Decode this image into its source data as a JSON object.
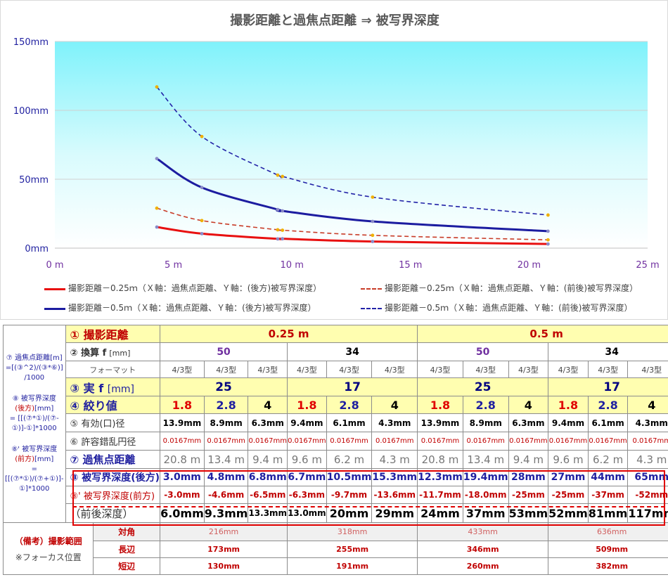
{
  "chart_data": {
    "type": "line",
    "title": "撮影距離と過焦点距離 ⇒ 被写界深度",
    "xlim": [
      0,
      25
    ],
    "ylim": [
      0,
      150
    ],
    "x_ticks": [
      "0 m",
      "5 m",
      "10 m",
      "15 m",
      "20 m",
      "25 m"
    ],
    "y_ticks": [
      "0mm",
      "50mm",
      "100mm",
      "150mm"
    ],
    "legend_position": "bottom",
    "series": [
      {
        "name": "撮影距離－0.25ｍ（Ｘ軸：過焦点距離、Ｙ軸：(後方)被写界深度）",
        "color": "#e81010",
        "dash": false,
        "width": 3,
        "points": [
          [
            4.3,
            15.3
          ],
          [
            6.2,
            10.5
          ],
          [
            9.4,
            6.7
          ],
          [
            9.6,
            6.8
          ],
          [
            13.4,
            4.8
          ],
          [
            20.8,
            3.0
          ]
        ]
      },
      {
        "name": "撮影距離－0.25ｍ（Ｘ軸：過焦点距離、Ｙ軸：(前後)被写界深度）",
        "color": "#c83c28",
        "dash": true,
        "width": 1.6,
        "points": [
          [
            4.3,
            29
          ],
          [
            6.2,
            20
          ],
          [
            9.4,
            13.3
          ],
          [
            9.6,
            13.0
          ],
          [
            13.4,
            9.3
          ],
          [
            20.8,
            6.0
          ]
        ]
      },
      {
        "name": "撮影距離－0.5ｍ（Ｘ軸：過焦点距離、Ｙ軸：(後方)被写界深度）",
        "color": "#1c1ca0",
        "dash": false,
        "width": 3,
        "points": [
          [
            4.3,
            65
          ],
          [
            6.2,
            44
          ],
          [
            9.4,
            28
          ],
          [
            9.6,
            27
          ],
          [
            13.4,
            19.4
          ],
          [
            20.8,
            12.3
          ]
        ]
      },
      {
        "name": "撮影距離－0.5ｍ（Ｘ軸：過焦点距離、Ｙ軸：(前後)被写界深度）",
        "color": "#2323a8",
        "dash": true,
        "width": 1.6,
        "points": [
          [
            4.3,
            117
          ],
          [
            6.2,
            81
          ],
          [
            9.4,
            53
          ],
          [
            9.6,
            52
          ],
          [
            13.4,
            37
          ],
          [
            20.8,
            24
          ]
        ]
      }
    ]
  },
  "table": {
    "side_hyperfocal": "⑦ 過焦点距離[m] =[(③^2)/(③*⑥)] /1000",
    "side_rear_t1": "⑧ 被写界深度",
    "side_rear_t2": "(後方)",
    "side_rear_t3": "[mm]",
    "side_rear_f": "= [[(⑦*①)/(⑦-①)]-①]*1000",
    "side_front_t1": "⑧' 被写界深度",
    "side_front_t2": "(前方)",
    "side_front_t3": "[mm]",
    "side_front_f": "= [[(⑦*①)/(⑦+①)]-①]*1000",
    "row_distance": {
      "label": "① 撮影距離",
      "v025": "0.25 m",
      "v05": "0.5 m"
    },
    "row_equiv": {
      "label": "② 換算 f",
      "unit": "[mm]",
      "vals": [
        "50",
        "34",
        "50",
        "34"
      ]
    },
    "row_format": {
      "label": "フォーマット",
      "vals": [
        "4/3型",
        "4/3型",
        "4/3型",
        "4/3型",
        "4/3型",
        "4/3型",
        "4/3型",
        "4/3型",
        "4/3型",
        "4/3型",
        "4/3型",
        "4/3型"
      ]
    },
    "row_actual": {
      "label": "③ 実 f",
      "unit": "[mm]",
      "vals": [
        "25",
        "17",
        "25",
        "17"
      ]
    },
    "row_fnum": {
      "label": "④ 絞り値",
      "vals": [
        "1.8",
        "2.8",
        "4",
        "1.8",
        "2.8",
        "4",
        "1.8",
        "2.8",
        "4",
        "1.8",
        "2.8",
        "4"
      ]
    },
    "row_diameter": {
      "label": "⑤ 有効(口)径",
      "vals": [
        "13.9mm",
        "8.9mm",
        "6.3mm",
        "9.4mm",
        "6.1mm",
        "4.3mm",
        "13.9mm",
        "8.9mm",
        "6.3mm",
        "9.4mm",
        "6.1mm",
        "4.3mm"
      ]
    },
    "row_coc": {
      "label": "⑥ 許容錯乱円径",
      "vals": [
        "0.0167mm",
        "0.0167mm",
        "0.0167mm",
        "0.0167mm",
        "0.0167mm",
        "0.0167mm",
        "0.0167mm",
        "0.0167mm",
        "0.0167mm",
        "0.0167mm",
        "0.0167mm",
        "0.0167mm"
      ]
    },
    "row_hyper": {
      "label": "⑦ 過焦点距離",
      "vals": [
        "20.8 m",
        "13.4 m",
        "9.4 m",
        "9.6 m",
        "6.2 m",
        "4.3 m",
        "20.8 m",
        "13.4 m",
        "9.4 m",
        "9.6 m",
        "6.2 m",
        "4.3 m"
      ]
    },
    "row_rear": {
      "label": "⑧ 被写界深度(後方)",
      "vals": [
        "3.0mm",
        "4.8mm",
        "6.8mm",
        "6.7mm",
        "10.5mm",
        "15.3mm",
        "12.3mm",
        "19.4mm",
        "28mm",
        "27mm",
        "44mm",
        "65mm"
      ]
    },
    "row_front": {
      "label": "⑧' 被写界深度(前方)",
      "vals": [
        "-3.0mm",
        "-4.6mm",
        "-6.5mm",
        "-6.3mm",
        "-9.7mm",
        "-13.6mm",
        "-11.7mm",
        "-18.0mm",
        "-25mm",
        "-25mm",
        "-37mm",
        "-52mm"
      ]
    },
    "row_total": {
      "label": "（前後深度）",
      "vals": [
        "6.0mm",
        "9.3mm",
        "13.3mm",
        "13.0mm",
        "20mm",
        "29mm",
        "24mm",
        "37mm",
        "53mm",
        "52mm",
        "81mm",
        "117mm"
      ]
    },
    "range_label_1": "（備考）撮影範囲",
    "range_label_2": "※フォーカス位置",
    "row_diag": {
      "label": "対角",
      "vals": [
        "216mm",
        "318mm",
        "433mm",
        "636mm"
      ]
    },
    "row_long": {
      "label": "長辺",
      "vals": [
        "173mm",
        "255mm",
        "346mm",
        "509mm"
      ]
    },
    "row_short": {
      "label": "短辺",
      "vals": [
        "130mm",
        "191mm",
        "260mm",
        "382mm"
      ]
    }
  }
}
